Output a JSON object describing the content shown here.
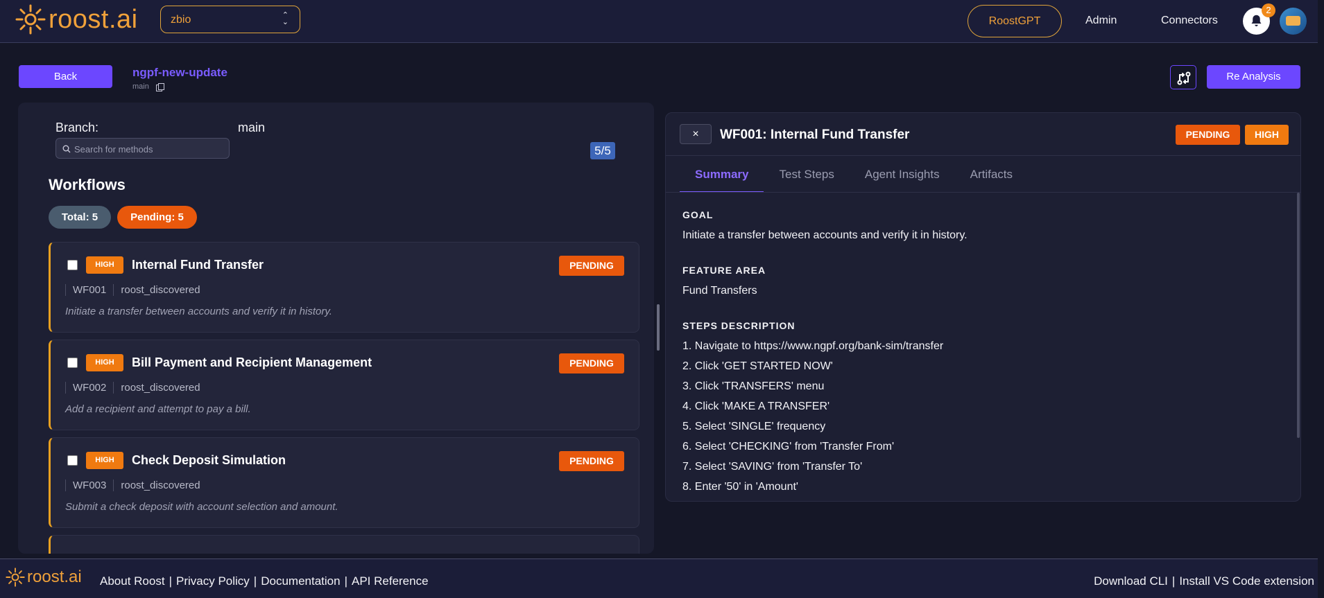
{
  "header": {
    "logo_text": "roost.ai",
    "project": "zbio",
    "nav": {
      "roostgpt": "RoostGPT",
      "admin": "Admin",
      "connectors": "Connectors"
    },
    "notification_count": "2"
  },
  "subheader": {
    "back_label": "Back",
    "title": "ngpf-new-update",
    "branch_small": "main",
    "reanalysis_label": "Re Analysis"
  },
  "left": {
    "branch_label": "Branch:",
    "branch_value": "main",
    "search_placeholder": "Search for methods",
    "count": "5/5",
    "workflows_title": "Workflows",
    "total_pill": "Total: 5",
    "pending_pill": "Pending: 5",
    "cards": [
      {
        "priority": "HIGH",
        "title": "Internal Fund Transfer",
        "status": "PENDING",
        "id": "WF001",
        "source": "roost_discovered",
        "desc": "Initiate a transfer between accounts and verify it in history."
      },
      {
        "priority": "HIGH",
        "title": "Bill Payment and Recipient Management",
        "status": "PENDING",
        "id": "WF002",
        "source": "roost_discovered",
        "desc": "Add a recipient and attempt to pay a bill."
      },
      {
        "priority": "HIGH",
        "title": "Check Deposit Simulation",
        "status": "PENDING",
        "id": "WF003",
        "source": "roost_discovered",
        "desc": "Submit a check deposit with account selection and amount."
      }
    ]
  },
  "detail": {
    "close": "×",
    "title": "WF001: Internal Fund Transfer",
    "status": "PENDING",
    "priority": "HIGH",
    "tabs": [
      "Summary",
      "Test Steps",
      "Agent Insights",
      "Artifacts"
    ],
    "goal_h": "GOAL",
    "goal": "Initiate a transfer between accounts and verify it in history.",
    "feature_h": "FEATURE AREA",
    "feature": "Fund Transfers",
    "steps_h": "STEPS DESCRIPTION",
    "steps": [
      "1. Navigate to https://www.ngpf.org/bank-sim/transfer",
      "2. Click 'GET STARTED NOW'",
      "3. Click 'TRANSFERS' menu",
      "4. Click 'MAKE A TRANSFER'",
      "5. Select 'SINGLE' frequency",
      "6. Select 'CHECKING' from 'Transfer From'",
      "7. Select 'SAVING' from 'Transfer To'",
      "8. Enter '50' in 'Amount'"
    ]
  },
  "footer": {
    "logo_text": "roost.ai",
    "links": [
      "About Roost",
      "Privacy Policy",
      "Documentation",
      "API Reference"
    ],
    "right_links": [
      "Download CLI",
      "Install VS Code extension"
    ]
  },
  "colors": {
    "accent": "#6c47ff",
    "brand": "#f0a13a",
    "pending": "#e8580c",
    "high": "#f07a10"
  }
}
